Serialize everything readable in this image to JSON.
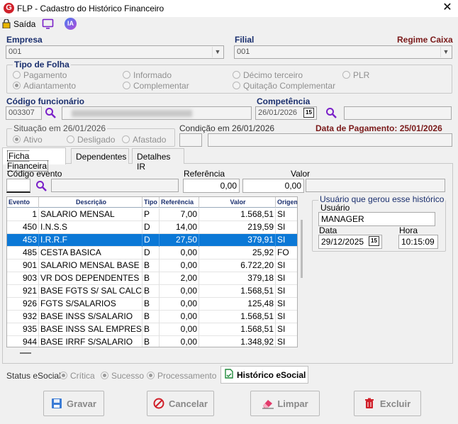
{
  "window": {
    "title": "FLP - Cadastro do Histórico Financeiro",
    "close": "✕"
  },
  "toolbar": {
    "saida_label": "Saída",
    "ia_label": "IA"
  },
  "empresa": {
    "label": "Empresa",
    "value": "001"
  },
  "filial": {
    "label": "Filial",
    "value": "001",
    "regime": "Regime Caixa"
  },
  "tipo_folha": {
    "legend": "Tipo de Folha",
    "options": [
      "Pagamento",
      "Informado",
      "Décimo terceiro",
      "PLR",
      "Adiantamento",
      "Complementar",
      "Quitação Complementar"
    ],
    "selected": "Adiantamento"
  },
  "funcionario": {
    "label": "Código funcionário",
    "code": "003307"
  },
  "competencia": {
    "label": "Competência",
    "value": "26/01/2026",
    "cal": "15"
  },
  "situacao": {
    "legend": "Situação em  26/01/2026",
    "options": [
      "Ativo",
      "Desligado",
      "Afastado"
    ],
    "selected": "Ativo"
  },
  "condicao": {
    "label": "Condição em 26/01/2026"
  },
  "pagamento": {
    "label": "Data de Pagamento: 25/01/2026"
  },
  "tabs": [
    "Ficha Financeira",
    "Dependentes",
    "Detalhes IR"
  ],
  "evento": {
    "label": "Código evento",
    "ref_label": "Referência",
    "val_label": "Valor",
    "ref_value": "0,00",
    "val_value": "0,00"
  },
  "table": {
    "headers": [
      "Evento",
      "Descrição",
      "Tipo",
      "Referência",
      "Valor",
      "Origem"
    ],
    "rows": [
      {
        "evento": "1",
        "descricao": "SALARIO MENSAL",
        "tipo": "P",
        "ref": "7,00",
        "valor": "1.568,51",
        "origem": "SI"
      },
      {
        "evento": "450",
        "descricao": "I.N.S.S",
        "tipo": "D",
        "ref": "14,00",
        "valor": "219,59",
        "origem": "SI"
      },
      {
        "evento": "453",
        "descricao": "I.R.R.F",
        "tipo": "D",
        "ref": "27,50",
        "valor": "379,91",
        "origem": "SI"
      },
      {
        "evento": "485",
        "descricao": "CESTA BASICA",
        "tipo": "D",
        "ref": "0,00",
        "valor": "25,92",
        "origem": "FO"
      },
      {
        "evento": "901",
        "descricao": "SALARIO MENSAL BASE",
        "tipo": "B",
        "ref": "0,00",
        "valor": "6.722,20",
        "origem": "SI"
      },
      {
        "evento": "903",
        "descricao": "VR DOS DEPENDENTES",
        "tipo": "B",
        "ref": "2,00",
        "valor": "379,18",
        "origem": "SI"
      },
      {
        "evento": "921",
        "descricao": "BASE FGTS S/ SAL CALC",
        "tipo": "B",
        "ref": "0,00",
        "valor": "1.568,51",
        "origem": "SI"
      },
      {
        "evento": "926",
        "descricao": "FGTS S/SALARIOS",
        "tipo": "B",
        "ref": "0,00",
        "valor": "125,48",
        "origem": "SI"
      },
      {
        "evento": "932",
        "descricao": "BASE INSS S/SALARIO",
        "tipo": "B",
        "ref": "0,00",
        "valor": "1.568,51",
        "origem": "SI"
      },
      {
        "evento": "935",
        "descricao": "BASE INSS SAL EMPRESA",
        "tipo": "B",
        "ref": "0,00",
        "valor": "1.568,51",
        "origem": "SI"
      },
      {
        "evento": "944",
        "descricao": "BASE IRRF S/SALARIO",
        "tipo": "B",
        "ref": "0,00",
        "valor": "1.348,92",
        "origem": "SI"
      }
    ],
    "selected_index": 2
  },
  "usuario_group": {
    "legend": "Usuário que gerou esse histórico",
    "user_label": "Usuário",
    "user_value": "MANAGER",
    "date_label": "Data",
    "date_value": "29/12/2025",
    "cal": "15",
    "hour_label": "Hora",
    "hour_value": "10:15:09"
  },
  "status": {
    "label": "Status eSocial:",
    "options": [
      "Crítica",
      "Sucesso",
      "Processamento"
    ],
    "historico_button": "Histórico eSocial"
  },
  "buttons": {
    "gravar": "Gravar",
    "cancelar": "Cancelar",
    "limpar": "Limpar",
    "excluir": "Excluir"
  },
  "colors": {
    "accent": "#1a2f6e",
    "selection": "#0b78d6",
    "regime": "#7a1a1a"
  }
}
